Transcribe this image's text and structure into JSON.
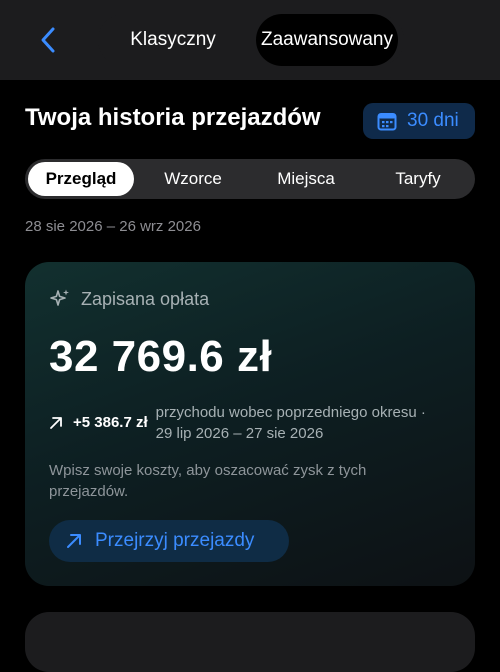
{
  "header": {
    "back_icon": "chevron-left-icon",
    "modes": [
      "Klasyczny",
      "Zaawansowany"
    ],
    "active_mode": "Zaawansowany"
  },
  "page": {
    "title": "Twoja historia przejazdów",
    "range_button": {
      "icon": "calendar-icon",
      "label": "30 dni"
    }
  },
  "tabs": [
    {
      "label": "Przegląd",
      "active": true
    },
    {
      "label": "Wzorce",
      "active": false
    },
    {
      "label": "Miejsca",
      "active": false
    },
    {
      "label": "Taryfy",
      "active": false
    }
  ],
  "date_range": "28 sie 2026 – 26 wrz 2026",
  "card": {
    "icon": "sparkle-icon",
    "label": "Zapisana opłata",
    "amount": "32 769.6 zł",
    "delta": {
      "icon": "arrow-up-right-icon",
      "value": "+5 386.7 zł",
      "description_line1": "przychodu wobec poprzedniego okresu ·",
      "description_line2": "29 lip 2026 – 27 sie 2026"
    },
    "note": "Wpisz swoje koszty, aby oszacować zysk z tych przejazdów.",
    "action": {
      "icon": "arrow-up-right-icon",
      "label": "Przejrzyj przejazdy"
    }
  },
  "colors": {
    "accent": "#3b8cff",
    "background": "#000000",
    "surface": "#1c1c1e"
  }
}
